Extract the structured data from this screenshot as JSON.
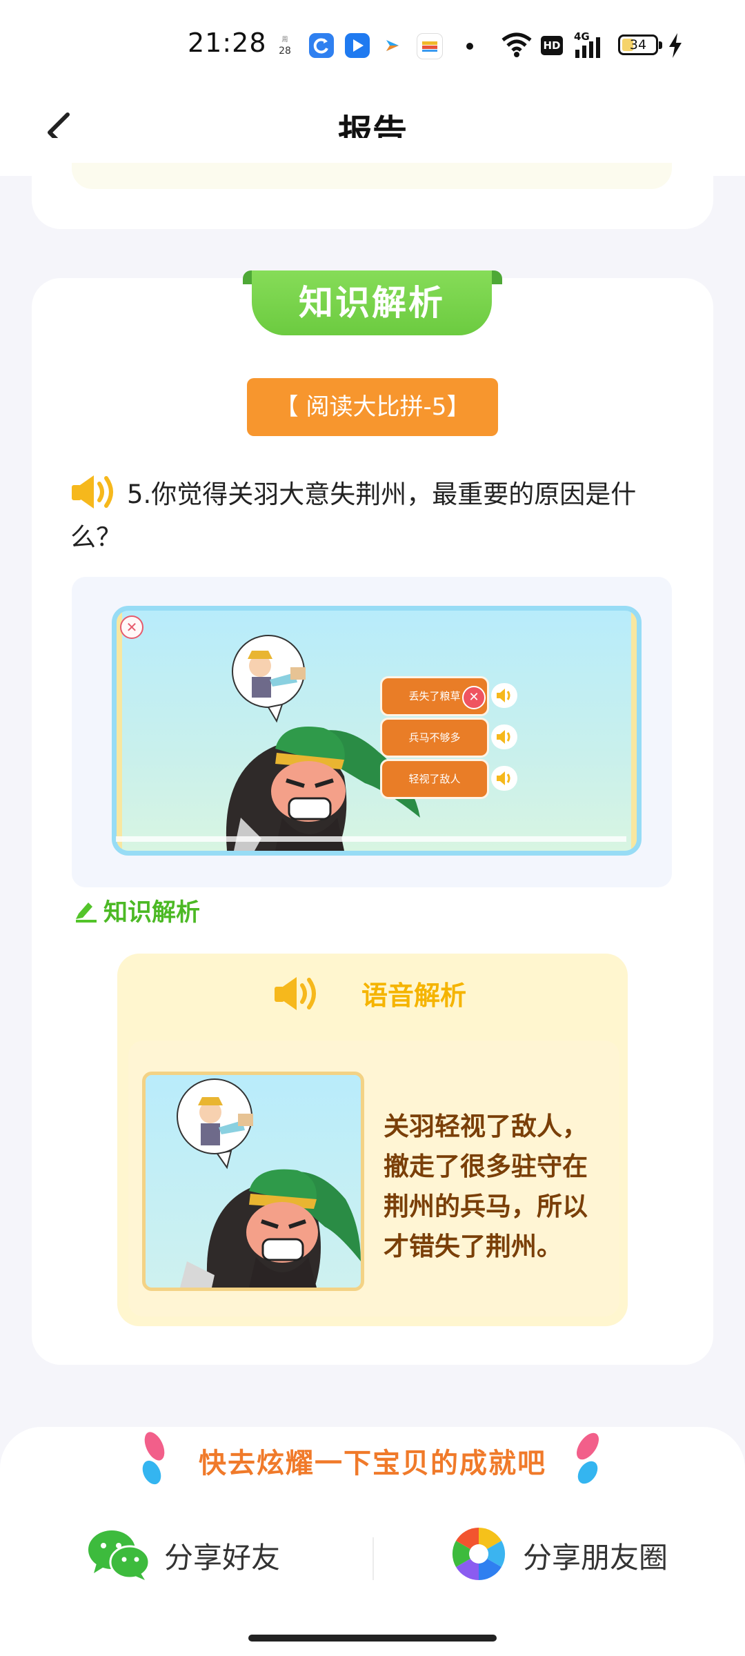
{
  "status_bar": {
    "time": "21:28",
    "date_day": "28",
    "battery": "34",
    "network": "4G",
    "hd": "HD"
  },
  "header": {
    "title": "报告"
  },
  "knowledge_section": {
    "ribbon_title": "知识解析",
    "tag": "【 阅读大比拼-5】",
    "question": "5.你觉得关羽大意失荆州，最重要的原因是什么？",
    "screenshot_options": [
      "丢失了粮草",
      "兵马不够多",
      "轻视了敌人"
    ],
    "analysis_label": "知识解析",
    "voice_title": "语音解析",
    "voice_text": "关羽轻视了敌人，撤走了很多驻守在荆州的兵马，所以才错失了荆州。"
  },
  "share": {
    "title": "快去炫耀一下宝贝的成就吧",
    "friend_label": "分享好友",
    "moments_label": "分享朋友圈"
  },
  "colors": {
    "accent_green": "#6ccb40",
    "accent_orange": "#f7962e",
    "voice_yellow": "#f5b400"
  }
}
